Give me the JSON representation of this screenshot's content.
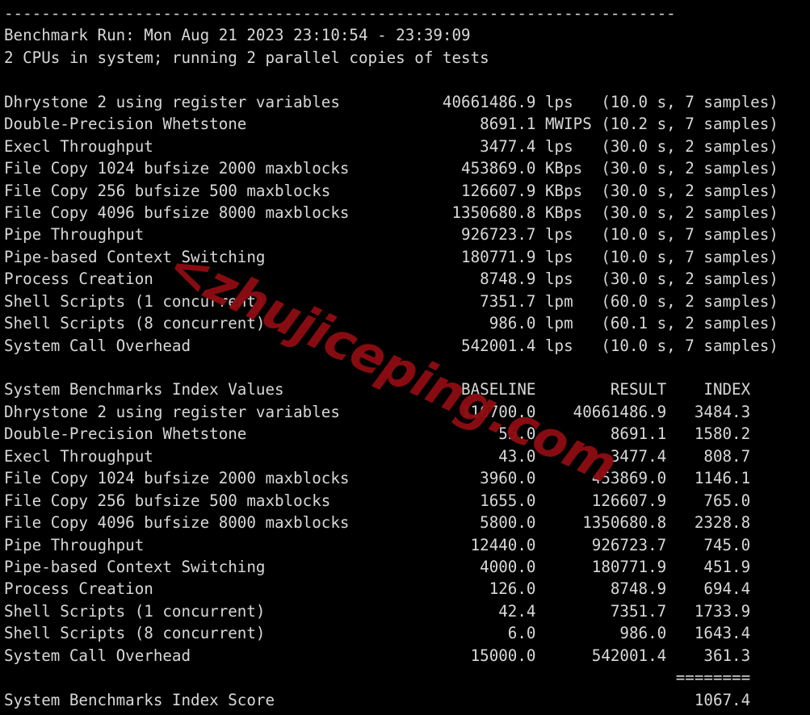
{
  "terminal": {
    "separator_line": "------------------------------------------------------------------------",
    "benchmark_run_line": "Benchmark Run: Mon Aug 21 2023 23:10:54 - 23:39:09",
    "cpu_line": "2 CPUs in system; running 2 parallel copies of tests",
    "index_section_header": "System Benchmarks Index Values",
    "index_score_label": "System Benchmarks Index Score",
    "index_score_value": "1067.4",
    "score_separator": "========",
    "columns": {
      "baseline": "BASELINE",
      "result": "RESULT",
      "index": "INDEX"
    }
  },
  "results": [
    {
      "name": "Dhrystone 2 using register variables",
      "value": "40661486.9",
      "unit": "lps",
      "detail": "(10.0 s, 7 samples)"
    },
    {
      "name": "Double-Precision Whetstone",
      "value": "8691.1",
      "unit": "MWIPS",
      "detail": "(10.2 s, 7 samples)"
    },
    {
      "name": "Execl Throughput",
      "value": "3477.4",
      "unit": "lps",
      "detail": "(30.0 s, 2 samples)"
    },
    {
      "name": "File Copy 1024 bufsize 2000 maxblocks",
      "value": "453869.0",
      "unit": "KBps",
      "detail": "(30.0 s, 2 samples)"
    },
    {
      "name": "File Copy 256 bufsize 500 maxblocks",
      "value": "126607.9",
      "unit": "KBps",
      "detail": "(30.0 s, 2 samples)"
    },
    {
      "name": "File Copy 4096 bufsize 8000 maxblocks",
      "value": "1350680.8",
      "unit": "KBps",
      "detail": "(30.0 s, 2 samples)"
    },
    {
      "name": "Pipe Throughput",
      "value": "926723.7",
      "unit": "lps",
      "detail": "(10.0 s, 7 samples)"
    },
    {
      "name": "Pipe-based Context Switching",
      "value": "180771.9",
      "unit": "lps",
      "detail": "(10.0 s, 7 samples)"
    },
    {
      "name": "Process Creation",
      "value": "8748.9",
      "unit": "lps",
      "detail": "(30.0 s, 2 samples)"
    },
    {
      "name": "Shell Scripts (1 concurrent)",
      "value": "7351.7",
      "unit": "lpm",
      "detail": "(60.0 s, 2 samples)"
    },
    {
      "name": "Shell Scripts (8 concurrent)",
      "value": "986.0",
      "unit": "lpm",
      "detail": "(60.1 s, 2 samples)"
    },
    {
      "name": "System Call Overhead",
      "value": "542001.4",
      "unit": "lps",
      "detail": "(10.0 s, 7 samples)"
    }
  ],
  "index_values": [
    {
      "name": "Dhrystone 2 using register variables",
      "baseline": "116700.0",
      "result": "40661486.9",
      "index": "3484.3"
    },
    {
      "name": "Double-Precision Whetstone",
      "baseline": "55.0",
      "result": "8691.1",
      "index": "1580.2"
    },
    {
      "name": "Execl Throughput",
      "baseline": "43.0",
      "result": "3477.4",
      "index": "808.7"
    },
    {
      "name": "File Copy 1024 bufsize 2000 maxblocks",
      "baseline": "3960.0",
      "result": "453869.0",
      "index": "1146.1"
    },
    {
      "name": "File Copy 256 bufsize 500 maxblocks",
      "baseline": "1655.0",
      "result": "126607.9",
      "index": "765.0"
    },
    {
      "name": "File Copy 4096 bufsize 8000 maxblocks",
      "baseline": "5800.0",
      "result": "1350680.8",
      "index": "2328.8"
    },
    {
      "name": "Pipe Throughput",
      "baseline": "12440.0",
      "result": "926723.7",
      "index": "745.0"
    },
    {
      "name": "Pipe-based Context Switching",
      "baseline": "4000.0",
      "result": "180771.9",
      "index": "451.9"
    },
    {
      "name": "Process Creation",
      "baseline": "126.0",
      "result": "8748.9",
      "index": "694.4"
    },
    {
      "name": "Shell Scripts (1 concurrent)",
      "baseline": "42.4",
      "result": "7351.7",
      "index": "1733.9"
    },
    {
      "name": "Shell Scripts (8 concurrent)",
      "baseline": "6.0",
      "result": "986.0",
      "index": "1643.4"
    },
    {
      "name": "System Call Overhead",
      "baseline": "15000.0",
      "result": "542001.4",
      "index": "361.3"
    }
  ],
  "watermark": {
    "text": "<zhujiceping.com",
    "color": "#8c0d12"
  }
}
